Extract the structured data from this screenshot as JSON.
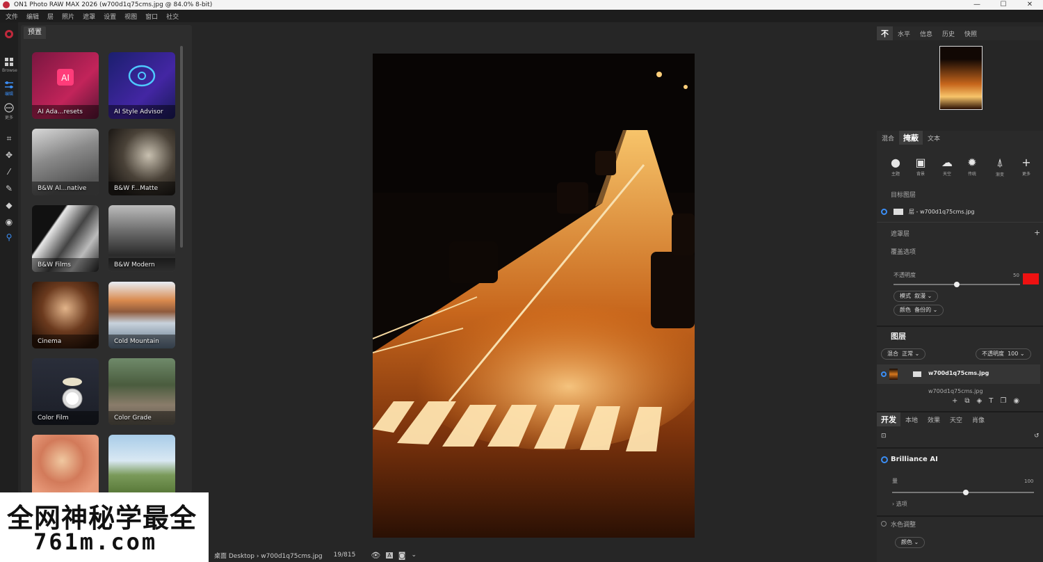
{
  "window": {
    "title": "ON1 Photo RAW MAX 2026 (w700d1q75cms.jpg @ 84.0% 8-bit)",
    "controls": [
      "—",
      "☐",
      "✕"
    ]
  },
  "menu": [
    "文件",
    "编辑",
    "层",
    "照片",
    "遮罩",
    "设置",
    "视图",
    "窗口",
    "社交"
  ],
  "toolbar": {
    "browse_label": "Browse",
    "edit_label": "编辑",
    "more_label": "更多"
  },
  "presets": {
    "tab": "预置",
    "items": [
      {
        "label": "AI Ada...resets"
      },
      {
        "label": "AI Style Advisor"
      },
      {
        "label": "B&W Al...native"
      },
      {
        "label": "B&W F...Matte"
      },
      {
        "label": "B&W Films"
      },
      {
        "label": "B&W Modern"
      },
      {
        "label": "Cinema"
      },
      {
        "label": "Cold Mountain"
      },
      {
        "label": "Color Film"
      },
      {
        "label": "Color Grade"
      }
    ]
  },
  "watermark": {
    "line1": "全网神秘学最全",
    "line2": "761m.com"
  },
  "status": {
    "path": "桌面 Desktop › w700d1q75cms.jpg",
    "count": "19/815"
  },
  "right": {
    "top_tabs": [
      "不",
      "水平",
      "信息",
      "历史",
      "快照"
    ],
    "mask_tabs": [
      "混合",
      "掩蔽",
      "文本"
    ],
    "mask_tools": [
      {
        "label": "主题",
        "icon": "person-icon"
      },
      {
        "label": "背景",
        "icon": "portrait-icon"
      },
      {
        "label": "天空",
        "icon": "weather-icon"
      },
      {
        "label": "传统",
        "icon": "lamp-icon"
      },
      {
        "label": "渐变",
        "icon": "gradient-icon"
      },
      {
        "label": "更多",
        "icon": "plus-icon"
      }
    ],
    "target_layer_label": "目标图层",
    "target_layer_name": "层 - w700d1q75cms.jpg",
    "mask_layer_label": "遮罩层",
    "overlay_label": "覆盖选项",
    "opacity_label": "不透明度",
    "opacity_value": "50",
    "opacity_fraction": 0.5,
    "mode_label": "模式",
    "mode_value": "叙漫",
    "color_label": "颜色",
    "color_value": "备份的",
    "overlay_color": "#ee1111",
    "layers_title": "图层",
    "blend_label": "混合",
    "blend_value": "正常",
    "layer_opacity_label": "不透明度",
    "layer_opacity_value": "100",
    "layers": [
      {
        "name": "w700d1q75cms.jpg"
      },
      {
        "name": "w700d1q75cms.jpg"
      }
    ],
    "dev_tabs": [
      "开发",
      "本地",
      "效果",
      "天空",
      "肖像"
    ],
    "brilliance_title": "Brilliance AI",
    "amount_label": "量",
    "amount_value": "100",
    "amount_fraction": 0.52,
    "details_label": "选项",
    "tone_label": "水色调整",
    "auto_label": "颜色"
  }
}
